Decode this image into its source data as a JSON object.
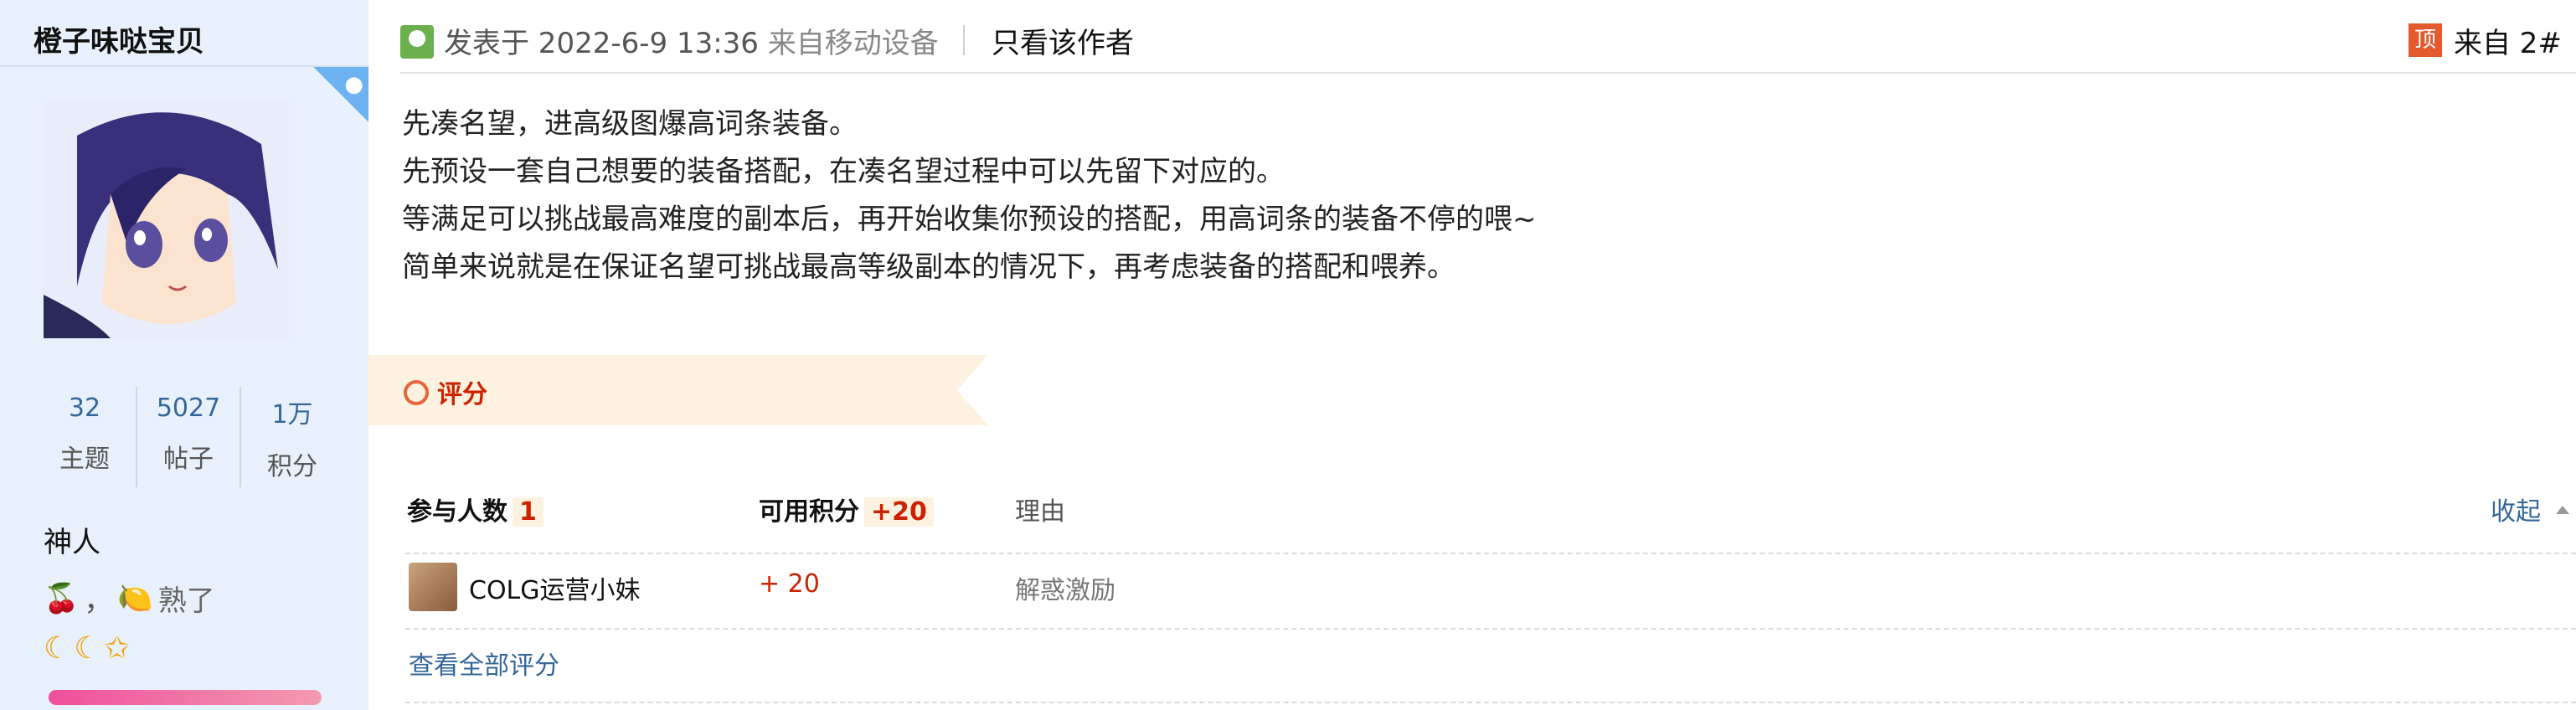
{
  "sidebar": {
    "username": "橙子味哒宝贝",
    "stats": [
      {
        "value": "32",
        "label": "主题"
      },
      {
        "value": "5027",
        "label": "帖子"
      },
      {
        "value": "1万",
        "label": "积分"
      }
    ],
    "rank": "神人",
    "medals_text": "，",
    "medal_label": "熟了",
    "medal_icons": [
      "cherry-icon",
      "lemon-icon"
    ],
    "star_icons": [
      "moon-icon",
      "moon-icon",
      "star-icon"
    ],
    "level_bar_color": "#ef4f9c"
  },
  "post": {
    "meta_prefix": "发表于 2022-6-9 13:36",
    "device": "来自移动设备",
    "only_author": "只看该作者",
    "top_badge": "顶",
    "floor": "来自 2#",
    "lines": [
      "先凑名望，进高级图爆高词条装备。",
      "先预设一套自己想要的装备搭配，在凑名望过程中可以先留下对应的。",
      "等满足可以挑战最高难度的副本后，再开始收集你预设的搭配，用高词条的装备不停的喂~",
      "简单来说就是在保证名望可挑战最高等级副本的情况下，再考虑装备的搭配和喂养。"
    ]
  },
  "rating": {
    "title": "评分",
    "participants_label": "参与人数",
    "participants_count": "1",
    "points_label": "可用积分",
    "points_value": "+20",
    "reason_label": "理由",
    "collapse_label": "收起",
    "rows": [
      {
        "user": "COLG运营小妹",
        "score": "+ 20",
        "reason": "解惑激励"
      }
    ],
    "view_all": "查看全部评分"
  },
  "colors": {
    "sidebar_bg": "#e8f1fb",
    "link": "#336699",
    "accent_red": "#cc2200",
    "banner_bg": "#fdf2e0"
  }
}
